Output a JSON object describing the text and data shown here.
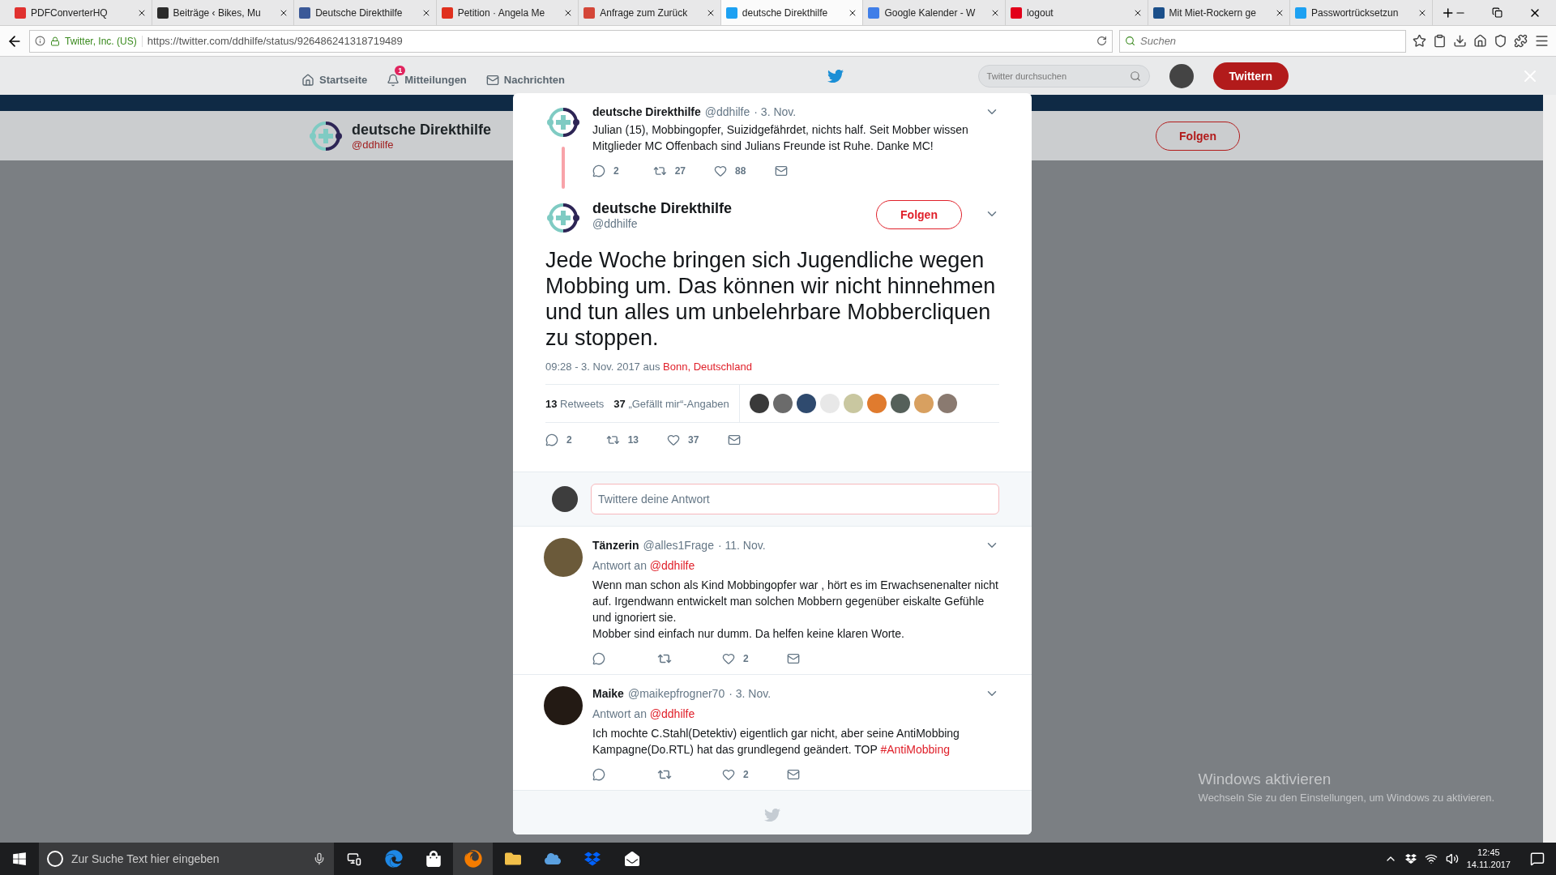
{
  "browser": {
    "tabs": [
      {
        "title": "PDFConverterHQ",
        "selected": false,
        "color": "#e0312f"
      },
      {
        "title": "Beiträge ‹ Bikes, Mu",
        "selected": false,
        "color": "#2b2b2b"
      },
      {
        "title": "Deutsche Direkthilfe",
        "selected": false,
        "color": "#3b5998"
      },
      {
        "title": "Petition · Angela Me",
        "selected": false,
        "color": "#e0301e"
      },
      {
        "title": "Anfrage zum Zurück",
        "selected": false,
        "color": "#d44638"
      },
      {
        "title": "deutsche Direkthilfe",
        "selected": true,
        "color": "#1da1f2"
      },
      {
        "title": "Google Kalender - W",
        "selected": false,
        "color": "#3f7ee8"
      },
      {
        "title": "logout",
        "selected": false,
        "color": "#e2001a"
      },
      {
        "title": "Mit Miet-Rockern ge",
        "selected": false,
        "color": "#1b4f8a"
      },
      {
        "title": "Passwortrücksetzun",
        "selected": false,
        "color": "#1da1f2"
      }
    ],
    "site_identity": "Twitter, Inc. (US)",
    "url": "https://twitter.com/ddhilfe/status/926486241318719489",
    "search_placeholder": "Suchen"
  },
  "twitter_nav": {
    "items": [
      {
        "label": "Startseite"
      },
      {
        "label": "Mitteilungen",
        "badge": "1"
      },
      {
        "label": "Nachrichten"
      }
    ],
    "search_placeholder": "Twitter durchsuchen",
    "tweet_button": "Twittern"
  },
  "profile_bar": {
    "name": "deutsche Direkthilfe",
    "handle": "@ddhilfe",
    "follow_button": "Folgen"
  },
  "modal": {
    "parent_tweet": {
      "name": "deutsche Direkthilfe",
      "handle": "@ddhilfe",
      "date": "· 3. Nov.",
      "text": "Julian (15), Mobbingopfer, Suizidgefährdet, nichts half. Seit Mobber wissen Mitglieder MC Offenbach sind Julians Freunde ist Ruhe. Danke MC!",
      "replies": "2",
      "retweets": "27",
      "likes": "88"
    },
    "main_tweet": {
      "name": "deutsche Direkthilfe",
      "handle": "@ddhilfe",
      "follow_button": "Folgen",
      "text": "Jede Woche bringen sich Jugendliche wegen Mobbing um. Das können wir nicht hinnehmen und tun alles um unbelehrbare Mobbercliquen zu stoppen.",
      "timestamp": "09:28 - 3. Nov. 2017 aus",
      "location": "Bonn, Deutschland",
      "retweet_count": "13",
      "retweet_label": "Retweets",
      "like_count": "37",
      "like_label": "„Gefällt mir“-Angaben",
      "liker_avatars": [
        {
          "color": "#3a3a3a"
        },
        {
          "color": "#6b6b6b"
        },
        {
          "color": "#2f4a6e"
        },
        {
          "color": "#e8e8e8"
        },
        {
          "color": "#c9c7a0"
        },
        {
          "color": "#e07b2e"
        },
        {
          "color": "#55605a"
        },
        {
          "color": "#d8a060"
        },
        {
          "color": "#8a7a70"
        }
      ],
      "replies": "2",
      "retweets": "13",
      "likes": "37"
    },
    "reply_placeholder": "Twittere deine Antwort",
    "replies": [
      {
        "name": "Tänzerin",
        "handle": "@alles1Frage",
        "date": "· 11. Nov.",
        "reply_to_label": "Antwort an",
        "reply_to": "@ddhilfe",
        "text": "Wenn man schon als Kind Mobbingopfer war , hört es im Erwachsenenalter nicht auf. Irgendwann entwickelt man solchen Mobbern gegenüber eiskalte Gefühle und ignoriert sie.\nMobber sind einfach nur dumm. Da helfen keine klaren Worte.",
        "likes": "2"
      },
      {
        "name": "Maike",
        "handle": "@maikepfrogner70",
        "date": "· 3. Nov.",
        "reply_to_label": "Antwort an",
        "reply_to": "@ddhilfe",
        "text": "Ich mochte C.Stahl(Detektiv) eigentlich gar nicht, aber seine  AntiMobbing Kampagne(Do.RTL) hat das grundlegend geändert. TOP ",
        "hashtag": "#AntiMobbing",
        "likes": "2"
      }
    ]
  },
  "windows_notice": {
    "title": "Windows aktivieren",
    "text": "Wechseln Sie zu den Einstellungen, um Windows zu aktivieren."
  },
  "taskbar": {
    "search_placeholder": "Zur Suche Text hier eingeben",
    "time": "12:45",
    "date": "14.11.2017"
  }
}
